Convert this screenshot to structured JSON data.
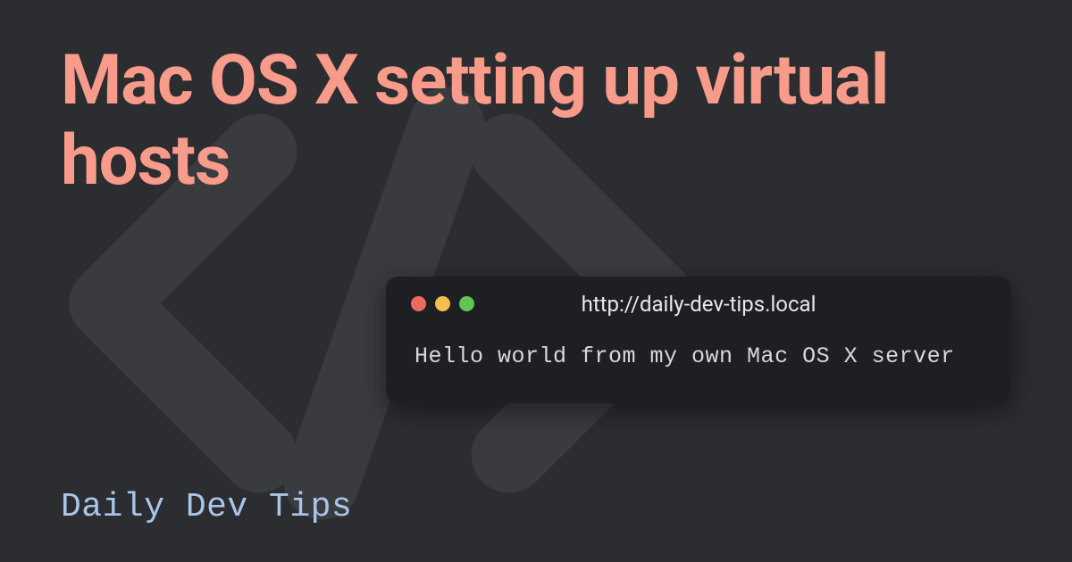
{
  "title": "Mac OS X setting up virtual hosts",
  "brand": "Daily Dev Tips",
  "window": {
    "url": "http://daily-dev-tips.local",
    "body": "Hello world from my own Mac OS X server"
  }
}
